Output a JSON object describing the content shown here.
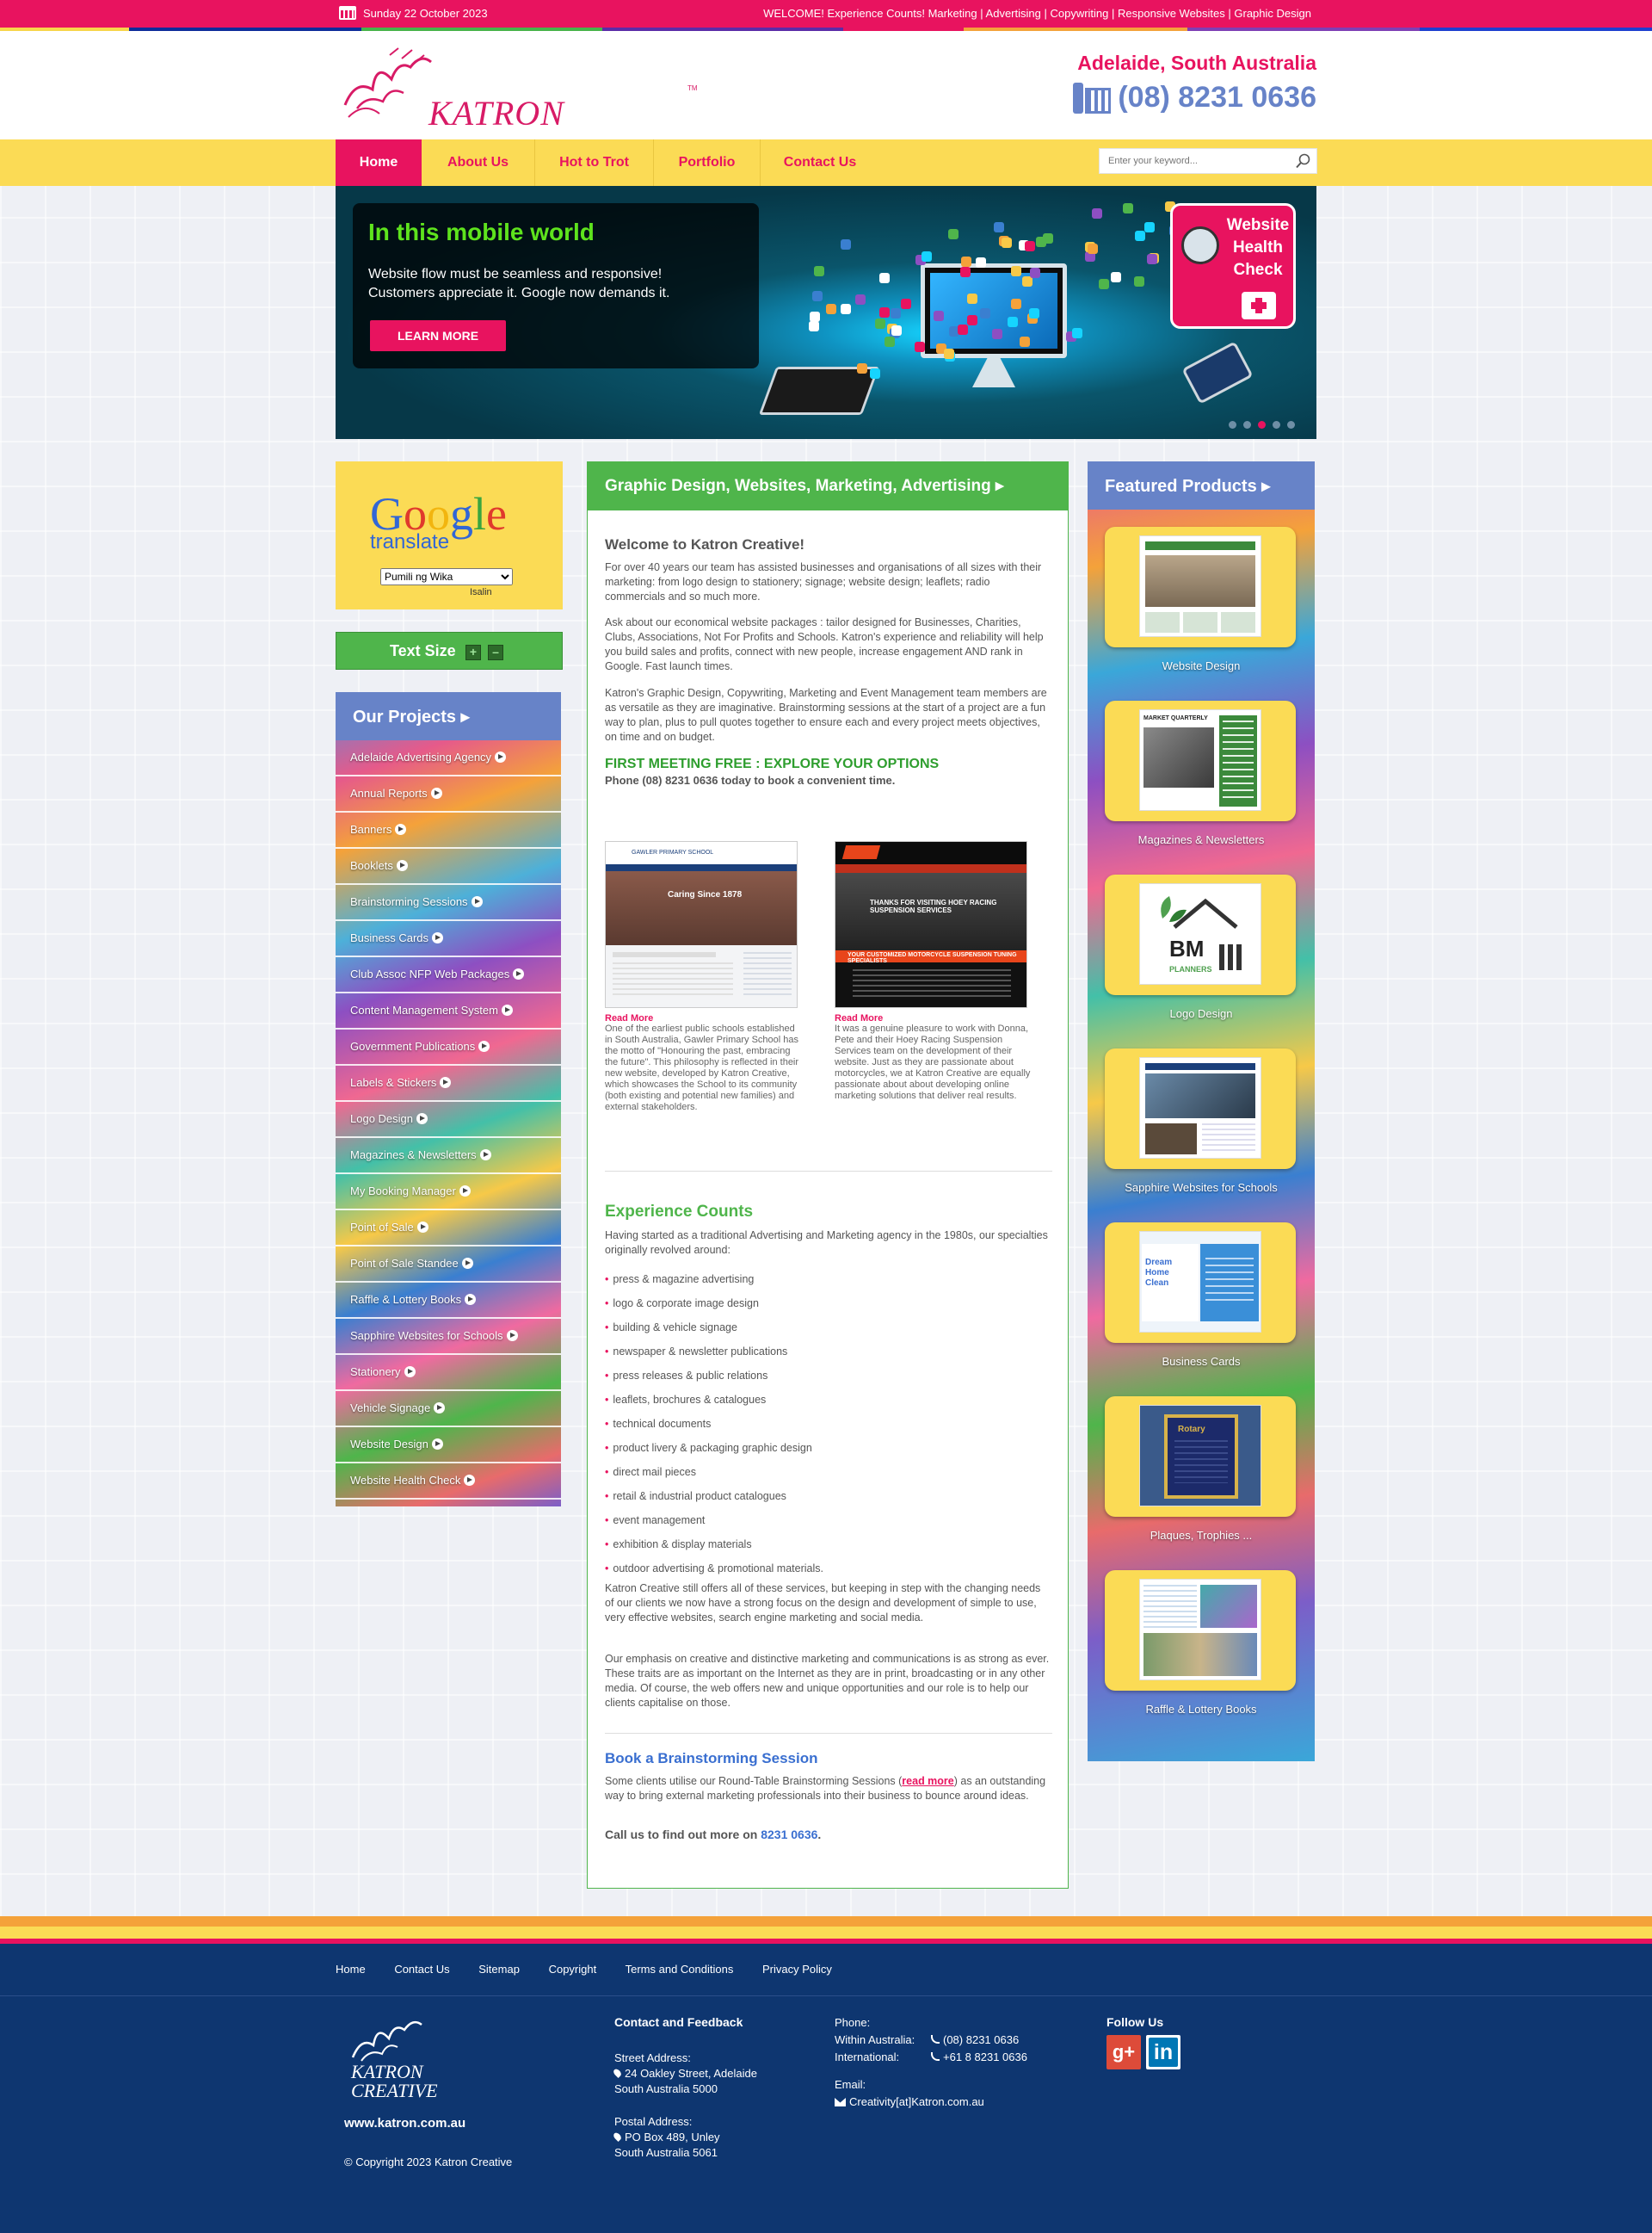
{
  "topbar": {
    "date": "Sunday 22 October 2023",
    "welcome": "WELCOME! Experience Counts! Marketing |",
    "links": [
      "Advertising |",
      "Copywriting |",
      "Responsive Websites |",
      "Graphic Design"
    ]
  },
  "header": {
    "logo_text": "KATRON CREATIVE",
    "logo_tm": "TM",
    "location": "Adelaide, South Australia",
    "phone": "(08) 8231 0636"
  },
  "nav": {
    "items": [
      "Home",
      "About Us",
      "Hot to Trot",
      "Portfolio",
      "Contact Us"
    ],
    "search_placeholder": "Enter your keyword..."
  },
  "banner": {
    "title": "In this mobile world",
    "text_line1": "Website flow must be seamless and responsive!",
    "text_line2": "Customers appreciate it. Google now demands it.",
    "button": "LEARN MORE",
    "badge": "Website Health Check",
    "active_slide": 3,
    "slide_count": 5
  },
  "sidebar": {
    "translate_google": "Google",
    "translate_word": "translate",
    "language_select": "Pumili ng Wika",
    "translate_caption": "Isalin",
    "text_size_label": "Text Size",
    "text_size_plus": "+",
    "text_size_minus": "–",
    "projects_title": "Our Projects",
    "projects": [
      "Adelaide Advertising Agency",
      "Annual Reports",
      "Banners",
      "Booklets",
      "Brainstorming Sessions",
      "Business Cards",
      "Club Assoc NFP Web Packages",
      "Content Management System",
      "Government Publications",
      "Labels & Stickers",
      "Logo Design",
      "Magazines & Newsletters",
      "My Booking Manager",
      "Point of Sale",
      "Point of Sale Standee",
      "Raffle & Lottery Books",
      "Sapphire Websites for Schools",
      "Stationery",
      "Vehicle Signage",
      "Website Design",
      "Website Health Check"
    ]
  },
  "main": {
    "heading": "Graphic Design, Websites, Marketing, Advertising",
    "welcome": "Welcome to Katron Creative!",
    "p1": "For over 40 years our team has assisted businesses and organisations of all sizes with their marketing: from logo design to stationery; signage; website design; leaflets; radio commercials and so much more.",
    "p2": "Ask about our economical website packages : tailor designed for Businesses, Charities, Clubs, Associations, Not For Profits and Schools. Katron's experience and reliability will help you build sales and profits, connect with new people, increase engagement AND rank in Google. Fast launch times.",
    "p3": "Katron's Graphic Design, Copywriting, Marketing and Event Management team members are as versatile as they are imaginative. Brainstorming sessions at the start of a project are a fun way to plan, plus to pull quotes together to ensure each and every project meets objectives, on time and on budget.",
    "free": "FIRST MEETING FREE : EXPLORE YOUR OPTIONS",
    "book_phone": "Phone (08) 8231 0636 today to book a convenient time.",
    "case1": {
      "shot_title": "GAWLER PRIMARY SCHOOL",
      "shot_hero": "Caring Since 1878",
      "read_more": "Read More",
      "text": "One of the earliest public schools established in South Australia, Gawler Primary School has the motto of \"Honouring the past, embracing the future\". This philosophy is reflected in their new website, developed by Katron Creative, which showcases the School to its community (both existing and potential new families) and external stakeholders."
    },
    "case2": {
      "shot_hero": "THANKS FOR VISITING HOEY RACING SUSPENSION SERVICES",
      "shot_strip": "YOUR CUSTOMIZED MOTORCYCLE SUSPENSION TUNING SPECIALISTS",
      "read_more": "Read More",
      "text": "It was a genuine pleasure to work with Donna, Pete and their Hoey Racing Suspension Services team on the development of their website. Just as they are passionate about motorcycles, we at Katron Creative are equally passionate about about developing online marketing solutions that deliver real results."
    },
    "experience_heading": "Experience Counts",
    "experience_intro": "Having started as a traditional Advertising and Marketing agency in the 1980s, our specialties originally revolved around:",
    "bullets": [
      "press & magazine advertising",
      "logo & corporate image design",
      "building & vehicle signage",
      "newspaper & newsletter publications",
      "press releases & public relations",
      "leaflets, brochures & catalogues",
      "technical documents",
      "product livery & packaging graphic design",
      "direct mail pieces",
      "retail & industrial product catalogues",
      "event management",
      "exhibition & display materials",
      "outdoor advertising & promotional materials."
    ],
    "p4": "Katron Creative still offers all of these services, but keeping in step with the changing needs of our clients we now have a strong focus on the design and development of simple to use, very effective websites, search engine marketing and social media.",
    "p5": "Our emphasis on creative and distinctive marketing and communications is as strong as ever. These traits are as important on the Internet as they are in print, broadcasting or in any other media. Of course, the web offers new and unique opportunities and our role is to help our clients capitalise on those.",
    "brainstorm_heading": "Book a Brainstorming Session",
    "brainstorm_text_a": "Some clients utilise our Round-Table Brainstorming Sessions (",
    "brainstorm_read_more": "read more",
    "brainstorm_text_b": ") as an outstanding way to bring external marketing professionals into their business to bounce around ideas.",
    "callus_a": "Call us to find out more on ",
    "callus_phone": "8231 0636",
    "callus_b": "."
  },
  "featured": {
    "title": "Featured Products",
    "items": [
      "Website Design",
      "Magazines & Newsletters",
      "Logo Design",
      "Sapphire Websites for Schools",
      "Business Cards",
      "Plaques, Trophies ...",
      "Raffle & Lottery Books"
    ],
    "thumb_magazine": "MARKET QUARTERLY",
    "thumb_logo": "BM",
    "thumb_logo_sub": "PLANNERS",
    "thumb_cards": "Dream Home Clean",
    "thumb_plaque": "Rotary"
  },
  "footer": {
    "links": [
      "Home",
      "Contact Us",
      "Sitemap",
      "Copyright",
      "Terms and Conditions",
      "Privacy Policy"
    ],
    "logo_text_1": "KATRON",
    "logo_text_2": "CREATIVE",
    "site": "www.katron.com.au",
    "copyright": "© Copyright 2023 Katron Creative",
    "contact_heading": "Contact and Feedback",
    "street_label": "Street Address:",
    "street_1": "24 Oakley Street, Adelaide",
    "street_2": "South Australia 5000",
    "postal_label": "Postal Address:",
    "postal_1": "PO Box 489, Unley",
    "postal_2": "South Australia 5061",
    "phone_label": "Phone:",
    "within_label": "Within Australia:",
    "within_value": "(08) 8231 0636",
    "intl_label": "International:",
    "intl_value": "+61 8 8231 0636",
    "email_label": "Email:",
    "email_value": "Creativity[at]Katron.com.au",
    "follow": "Follow Us"
  }
}
